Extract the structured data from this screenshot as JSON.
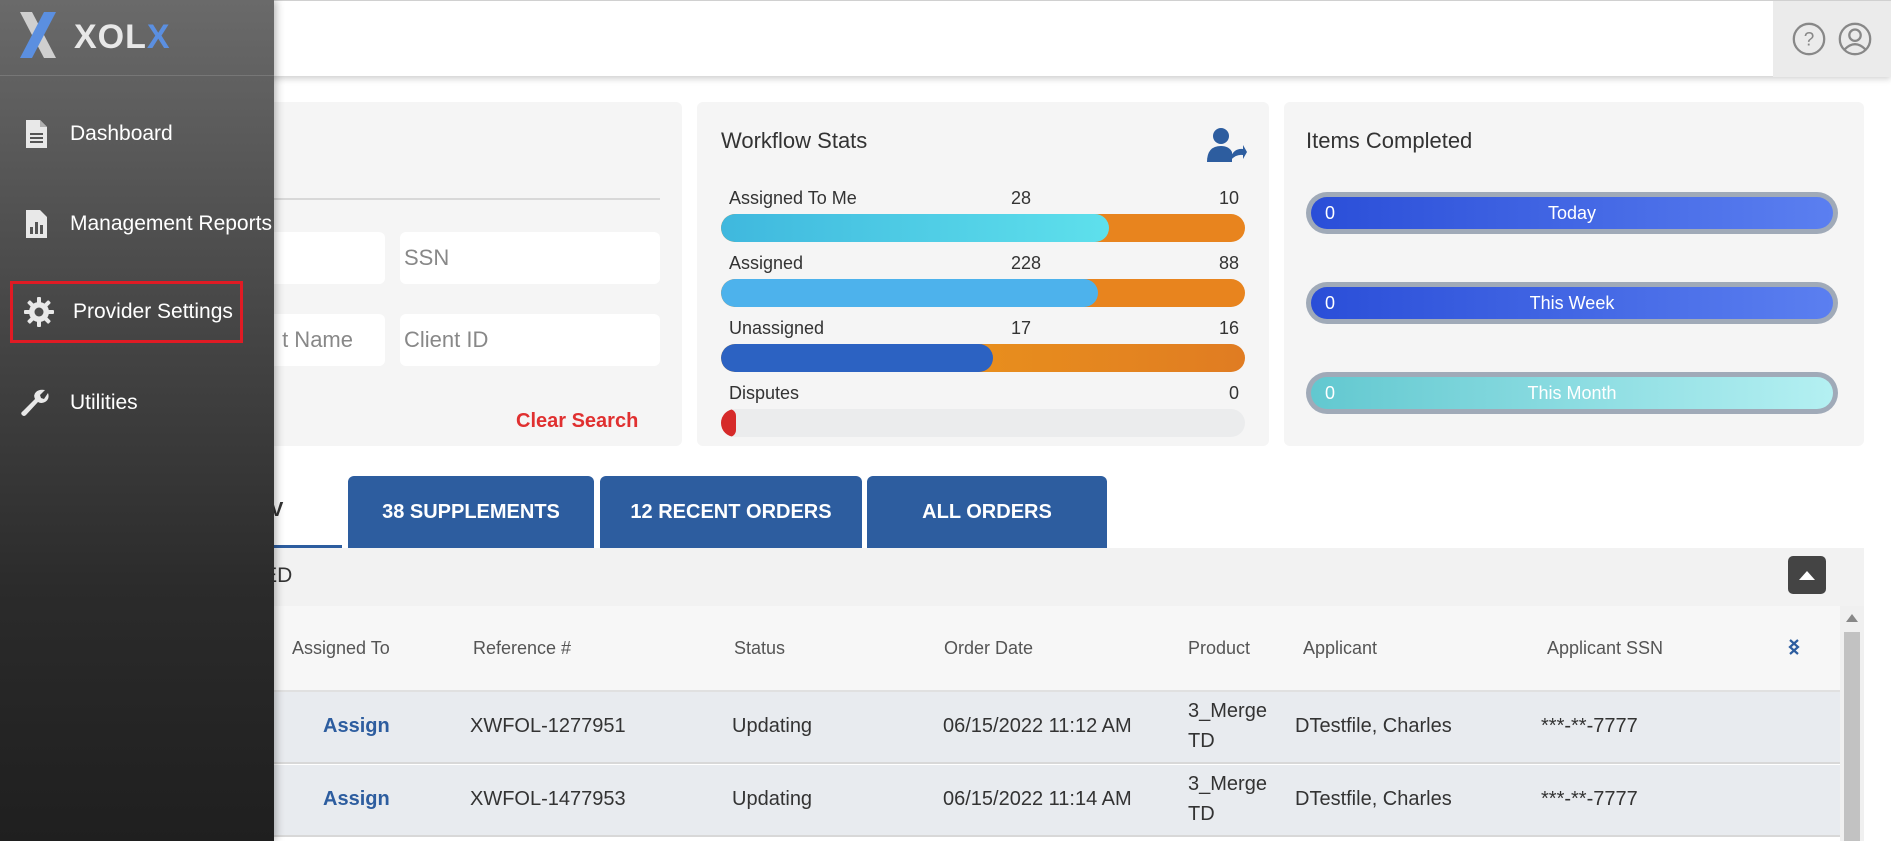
{
  "app": {
    "logo_prefix": "XOL",
    "logo_suffix": "X"
  },
  "sidebar": {
    "items": [
      {
        "label": "Dashboard",
        "icon": "document-icon"
      },
      {
        "label": "Management Reports",
        "icon": "report-chart-icon"
      },
      {
        "label": "Provider Settings",
        "icon": "gear-icon",
        "highlighted": true
      },
      {
        "label": "Utilities",
        "icon": "wrench-icon"
      }
    ]
  },
  "header": {
    "icons": [
      "help-icon",
      "user-account-icon"
    ]
  },
  "search": {
    "ssn_placeholder": "SSN",
    "last_name_placeholder": "t Name",
    "client_id_placeholder": "Client ID",
    "clear_label": "Clear Search"
  },
  "workflow": {
    "title": "Workflow Stats",
    "rows": [
      {
        "label": "Assigned To Me",
        "value1": "28",
        "value2": "10",
        "fill": 0.74
      },
      {
        "label": "Assigned",
        "value1": "228",
        "value2": "88",
        "fill": 0.72
      },
      {
        "label": "Unassigned",
        "value1": "17",
        "value2": "16",
        "fill": 0.52
      },
      {
        "label": "Disputes",
        "value2": "0"
      }
    ]
  },
  "items_completed": {
    "title": "Items Completed",
    "pills": [
      {
        "count": "0",
        "label": "Today"
      },
      {
        "count": "0",
        "label": "This Week"
      },
      {
        "count": "0",
        "label": "This Month"
      }
    ]
  },
  "tabs": {
    "active_partial": "V",
    "items": [
      "38 SUPPLEMENTS",
      "12 RECENT ORDERS",
      "ALL ORDERS"
    ]
  },
  "section": {
    "title_partial": "NED"
  },
  "table": {
    "headers": [
      "Assigned To",
      "Reference #",
      "Status",
      "Order Date",
      "Product",
      "Applicant",
      "Applicant SSN"
    ],
    "rows": [
      {
        "assigned": "Assign",
        "ref": "XWFOL-1277951",
        "status": "Updating",
        "date": "06/15/2022 11:12 AM",
        "product_l1": "3_Merge",
        "product_l2": "TD",
        "applicant": "DTestfile, Charles",
        "ssn": "***-**-7777"
      },
      {
        "assigned": "Assign",
        "ref": "XWFOL-1477953",
        "status": "Updating",
        "date": "06/15/2022 11:14 AM",
        "product_l1": "3_Merge",
        "product_l2": "TD",
        "applicant": "DTestfile, Charles",
        "ssn": "***-**-7777"
      }
    ]
  },
  "colors": {
    "primary": "#2d5d9f",
    "accent_orange": "#e8841e",
    "alert_red": "#e01b24"
  }
}
